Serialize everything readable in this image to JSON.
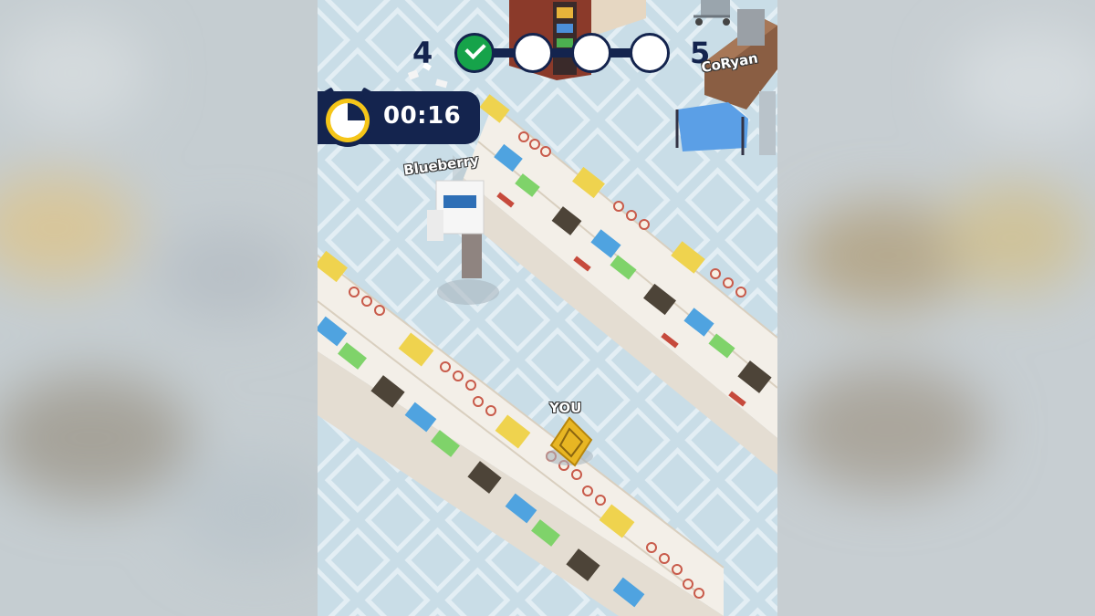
{
  "hud": {
    "score_left": "4",
    "score_right": "5",
    "progress": {
      "total_steps": 4,
      "completed_steps": 1
    },
    "timer": "00:16",
    "timer_remaining_fraction": 0.25
  },
  "players": {
    "self_label": "YOU",
    "opponent_label": "Blueberry",
    "offscreen_label": "CoRyan"
  },
  "colors": {
    "hud_navy": "#14244e",
    "check_green": "#16a34a",
    "timer_ring": "#f5c518",
    "floor": "#c9dde7",
    "shelf": "#f4f1ea",
    "player_gold": "#e8b623"
  },
  "icons": [
    "check-icon",
    "stopwatch-icon"
  ]
}
